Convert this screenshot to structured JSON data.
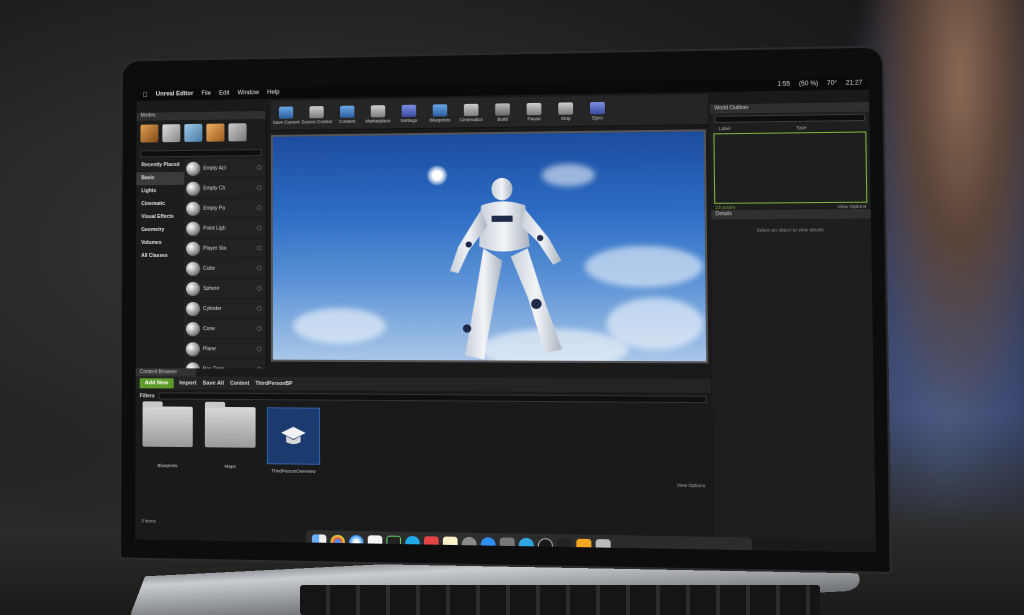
{
  "menubar": {
    "app_name": "Unreal Editor",
    "menus": [
      "File",
      "Edit",
      "Window",
      "Help"
    ],
    "clock_battery": "1:55",
    "battery_pct": "(50 %)",
    "temperature": "70°",
    "time": "21:27"
  },
  "toolbar": {
    "items": [
      "Save Current",
      "Source Control",
      "Content",
      "Marketplace",
      "Settings",
      "Blueprints",
      "Cinematics",
      "Build",
      "Pause",
      "Stop",
      "Eject"
    ]
  },
  "modes": {
    "title": "Modes",
    "categories": [
      "Recently Placed",
      "Basic",
      "Lights",
      "Cinematic",
      "Visual Effects",
      "Geometry",
      "Volumes",
      "All Classes"
    ],
    "actors": [
      "Empty Act",
      "Empty Ch",
      "Empty Pa",
      "Point Ligh",
      "Player Sta",
      "Cube",
      "Sphere",
      "Cylinder",
      "Cone",
      "Plane",
      "Box Trigg"
    ]
  },
  "outliner": {
    "title": "World Outliner",
    "col_label": "Label",
    "col_type": "Type",
    "actors_count": "23 actors",
    "view_options": "View Options"
  },
  "details": {
    "title": "Details",
    "hint": "Select an object to view details."
  },
  "content_browser": {
    "tab": "Content Browser",
    "add_new": "Add New",
    "import": "Import",
    "save_all": "Save All",
    "path_root": "Content",
    "path_sub": "ThirdPersonBP",
    "filters": "Filters",
    "assets": [
      {
        "label": "Blueprints",
        "kind": "folder"
      },
      {
        "label": "Maps",
        "kind": "folder"
      },
      {
        "label": "ThirdPersonOverview",
        "kind": "asset"
      }
    ],
    "items_count": "3 items",
    "view_options": "View Options"
  }
}
